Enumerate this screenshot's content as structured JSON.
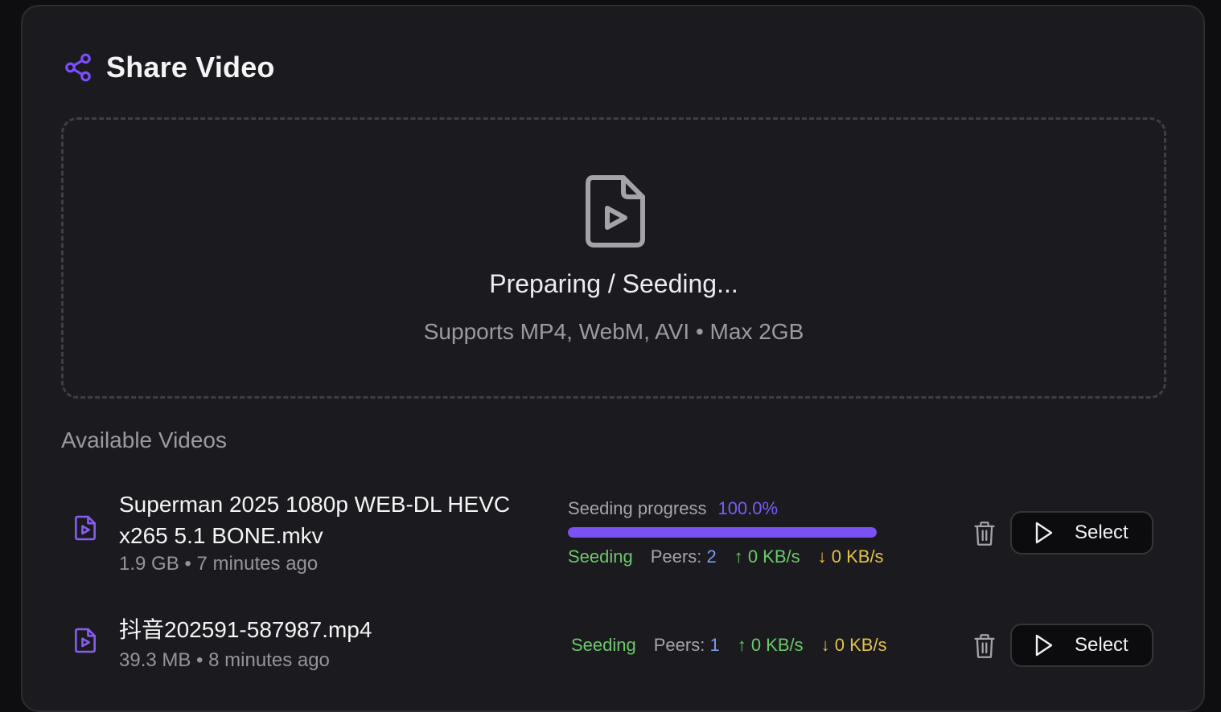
{
  "header": {
    "title": "Share Video",
    "icon": "share-icon",
    "accent": "#7c4dff"
  },
  "dropzone": {
    "icon": "file-video-icon",
    "status": "Preparing / Seeding...",
    "hint": "Supports MP4, WebM, AVI • Max 2GB"
  },
  "videos_section": {
    "title": "Available Videos",
    "items": [
      {
        "name": "Superman 2025 1080p WEB-DL HEVC x265 5.1 BONE.mkv",
        "size": "1.9 GB",
        "age": "7 minutes ago",
        "progress_label": "Seeding progress",
        "progress_value": "100.0%",
        "progress_fraction": 1.0,
        "status": "Seeding",
        "peers_label": "Peers:",
        "peers": "2",
        "upload": "↑ 0 KB/s",
        "download": "↓ 0 KB/s",
        "action_label": "Select"
      },
      {
        "name": "抖音202591-587987.mp4",
        "size": "39.3 MB",
        "age": "8 minutes ago",
        "status": "Seeding",
        "peers_label": "Peers:",
        "peers": "1",
        "upload": "↑ 0 KB/s",
        "download": "↓ 0 KB/s",
        "action_label": "Select"
      }
    ]
  },
  "separator": " • ",
  "colors": {
    "background": "#1b1b1f",
    "accent": "#7a52f4",
    "seeding": "#6cc869",
    "peers": "#7f97f0",
    "download": "#e2c24a"
  }
}
